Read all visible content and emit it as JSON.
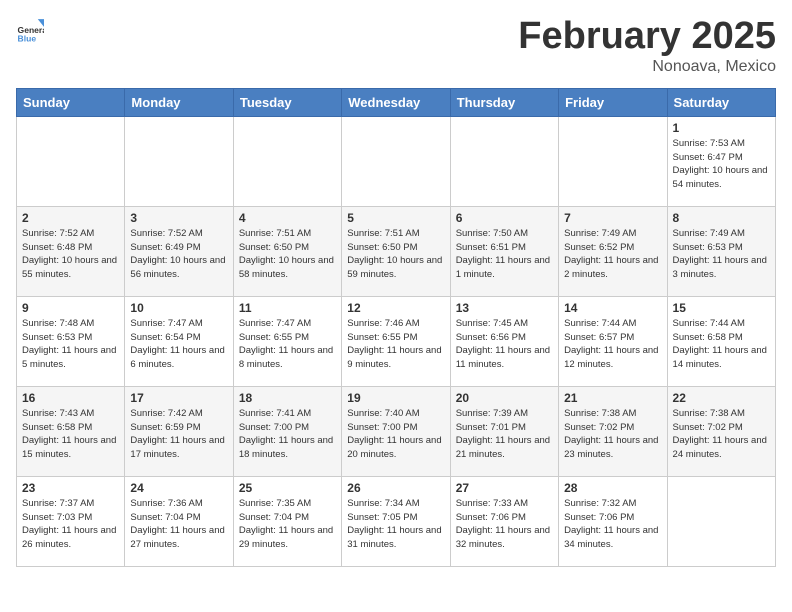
{
  "header": {
    "logo_general": "General",
    "logo_blue": "Blue",
    "month_title": "February 2025",
    "location": "Nonoava, Mexico"
  },
  "days_of_week": [
    "Sunday",
    "Monday",
    "Tuesday",
    "Wednesday",
    "Thursday",
    "Friday",
    "Saturday"
  ],
  "weeks": [
    [
      {
        "day": "",
        "text": ""
      },
      {
        "day": "",
        "text": ""
      },
      {
        "day": "",
        "text": ""
      },
      {
        "day": "",
        "text": ""
      },
      {
        "day": "",
        "text": ""
      },
      {
        "day": "",
        "text": ""
      },
      {
        "day": "1",
        "text": "Sunrise: 7:53 AM\nSunset: 6:47 PM\nDaylight: 10 hours and 54 minutes."
      }
    ],
    [
      {
        "day": "2",
        "text": "Sunrise: 7:52 AM\nSunset: 6:48 PM\nDaylight: 10 hours and 55 minutes."
      },
      {
        "day": "3",
        "text": "Sunrise: 7:52 AM\nSunset: 6:49 PM\nDaylight: 10 hours and 56 minutes."
      },
      {
        "day": "4",
        "text": "Sunrise: 7:51 AM\nSunset: 6:50 PM\nDaylight: 10 hours and 58 minutes."
      },
      {
        "day": "5",
        "text": "Sunrise: 7:51 AM\nSunset: 6:50 PM\nDaylight: 10 hours and 59 minutes."
      },
      {
        "day": "6",
        "text": "Sunrise: 7:50 AM\nSunset: 6:51 PM\nDaylight: 11 hours and 1 minute."
      },
      {
        "day": "7",
        "text": "Sunrise: 7:49 AM\nSunset: 6:52 PM\nDaylight: 11 hours and 2 minutes."
      },
      {
        "day": "8",
        "text": "Sunrise: 7:49 AM\nSunset: 6:53 PM\nDaylight: 11 hours and 3 minutes."
      }
    ],
    [
      {
        "day": "9",
        "text": "Sunrise: 7:48 AM\nSunset: 6:53 PM\nDaylight: 11 hours and 5 minutes."
      },
      {
        "day": "10",
        "text": "Sunrise: 7:47 AM\nSunset: 6:54 PM\nDaylight: 11 hours and 6 minutes."
      },
      {
        "day": "11",
        "text": "Sunrise: 7:47 AM\nSunset: 6:55 PM\nDaylight: 11 hours and 8 minutes."
      },
      {
        "day": "12",
        "text": "Sunrise: 7:46 AM\nSunset: 6:55 PM\nDaylight: 11 hours and 9 minutes."
      },
      {
        "day": "13",
        "text": "Sunrise: 7:45 AM\nSunset: 6:56 PM\nDaylight: 11 hours and 11 minutes."
      },
      {
        "day": "14",
        "text": "Sunrise: 7:44 AM\nSunset: 6:57 PM\nDaylight: 11 hours and 12 minutes."
      },
      {
        "day": "15",
        "text": "Sunrise: 7:44 AM\nSunset: 6:58 PM\nDaylight: 11 hours and 14 minutes."
      }
    ],
    [
      {
        "day": "16",
        "text": "Sunrise: 7:43 AM\nSunset: 6:58 PM\nDaylight: 11 hours and 15 minutes."
      },
      {
        "day": "17",
        "text": "Sunrise: 7:42 AM\nSunset: 6:59 PM\nDaylight: 11 hours and 17 minutes."
      },
      {
        "day": "18",
        "text": "Sunrise: 7:41 AM\nSunset: 7:00 PM\nDaylight: 11 hours and 18 minutes."
      },
      {
        "day": "19",
        "text": "Sunrise: 7:40 AM\nSunset: 7:00 PM\nDaylight: 11 hours and 20 minutes."
      },
      {
        "day": "20",
        "text": "Sunrise: 7:39 AM\nSunset: 7:01 PM\nDaylight: 11 hours and 21 minutes."
      },
      {
        "day": "21",
        "text": "Sunrise: 7:38 AM\nSunset: 7:02 PM\nDaylight: 11 hours and 23 minutes."
      },
      {
        "day": "22",
        "text": "Sunrise: 7:38 AM\nSunset: 7:02 PM\nDaylight: 11 hours and 24 minutes."
      }
    ],
    [
      {
        "day": "23",
        "text": "Sunrise: 7:37 AM\nSunset: 7:03 PM\nDaylight: 11 hours and 26 minutes."
      },
      {
        "day": "24",
        "text": "Sunrise: 7:36 AM\nSunset: 7:04 PM\nDaylight: 11 hours and 27 minutes."
      },
      {
        "day": "25",
        "text": "Sunrise: 7:35 AM\nSunset: 7:04 PM\nDaylight: 11 hours and 29 minutes."
      },
      {
        "day": "26",
        "text": "Sunrise: 7:34 AM\nSunset: 7:05 PM\nDaylight: 11 hours and 31 minutes."
      },
      {
        "day": "27",
        "text": "Sunrise: 7:33 AM\nSunset: 7:06 PM\nDaylight: 11 hours and 32 minutes."
      },
      {
        "day": "28",
        "text": "Sunrise: 7:32 AM\nSunset: 7:06 PM\nDaylight: 11 hours and 34 minutes."
      },
      {
        "day": "",
        "text": ""
      }
    ]
  ]
}
